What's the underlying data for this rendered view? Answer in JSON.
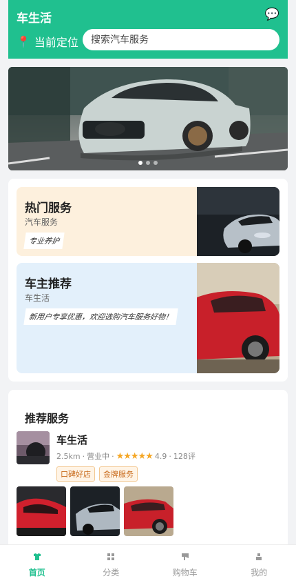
{
  "header": {
    "title": "车生活",
    "location_label": "当前定位",
    "search_placeholder": "搜索汽车服务"
  },
  "banner": {
    "slide_count": 3,
    "active_index": 0
  },
  "cards": [
    {
      "title": "热门服务",
      "subtitle": "汽车服务",
      "tag": "专业养护",
      "bg": "#fdf0dd"
    },
    {
      "title": "车主推荐",
      "subtitle": "车生活",
      "tag": "新用户专享优惠，欢迎选购汽车服务好物！",
      "bg": "#e3f0fb"
    }
  ],
  "recommend": {
    "title": "推荐服务",
    "shop": {
      "name": "车生活",
      "distance": "2.5km",
      "status": "营业中",
      "rating_stars": 5,
      "rating": "4.9",
      "reviews": "128评",
      "badges": [
        "口碑好店",
        "金牌服务"
      ]
    }
  },
  "tabbar": {
    "active_color": "#20c08f",
    "items": [
      {
        "label": "首页",
        "icon": "shirt-icon",
        "active": true
      },
      {
        "label": "分类",
        "icon": "grid-icon",
        "active": false
      },
      {
        "label": "购物车",
        "icon": "flag-icon",
        "active": false
      },
      {
        "label": "我的",
        "icon": "person-icon",
        "active": false
      }
    ]
  },
  "colors": {
    "brand": "#20c08f",
    "star": "#f5a623",
    "badge_text": "#c86a1b"
  }
}
